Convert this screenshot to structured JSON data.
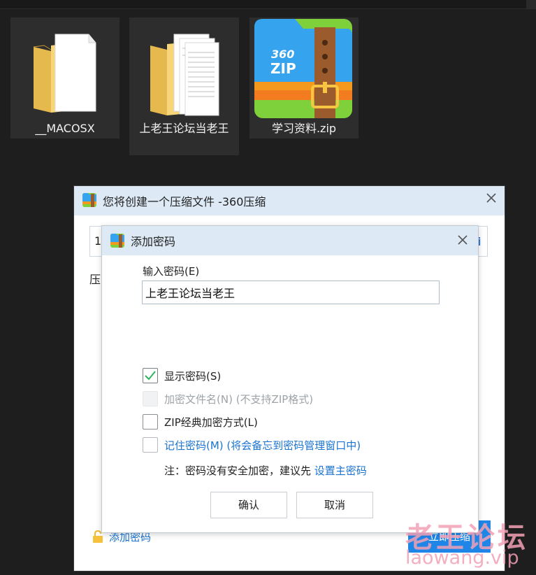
{
  "desktop": {
    "items": [
      {
        "label": "__MACOSX",
        "icon": "folder-icon"
      },
      {
        "label": "上老王论坛当老王",
        "icon": "folder-with-documents-icon"
      },
      {
        "label": "学习资料.zip",
        "icon": "360zip-archive-icon",
        "logo_text": "360 ZIP"
      }
    ]
  },
  "outer_dialog": {
    "title": "您将创建一个压缩文件 -360压缩",
    "field_value": "1",
    "label_fragment": "压",
    "add_password_link": "添加密码",
    "compress_button": "立即压缩"
  },
  "password_dialog": {
    "title": "添加密码",
    "input_label": "输入密码(E)",
    "password_value": "上老王论坛当老王",
    "options": [
      {
        "label": "显示密码(S)",
        "checked": true,
        "enabled": true,
        "style": "normal"
      },
      {
        "label": "加密文件名(N) (不支持ZIP格式)",
        "checked": false,
        "enabled": false,
        "style": "disabled"
      },
      {
        "label": "ZIP经典加密方式(L)",
        "checked": false,
        "enabled": true,
        "style": "normal"
      },
      {
        "label": "记住密码(M) (将会备忘到密码管理窗口中)",
        "checked": false,
        "enabled": true,
        "style": "link"
      }
    ],
    "note_prefix": "注：密码没有安全加密，建议先",
    "note_link": "设置主密码",
    "ok_button": "确认",
    "cancel_button": "取消"
  },
  "watermark": {
    "line1": "老王论坛",
    "line2": "laowang.vip"
  },
  "colors": {
    "desktop_bg": "#1e1e1e",
    "tile_bg": "#2d2d2d",
    "title_bar": "#ddeaf6",
    "link": "#1a73d0",
    "checkmark": "#2db55d",
    "primary_button": "#1f86e8",
    "watermark": "#f2a0b5"
  }
}
